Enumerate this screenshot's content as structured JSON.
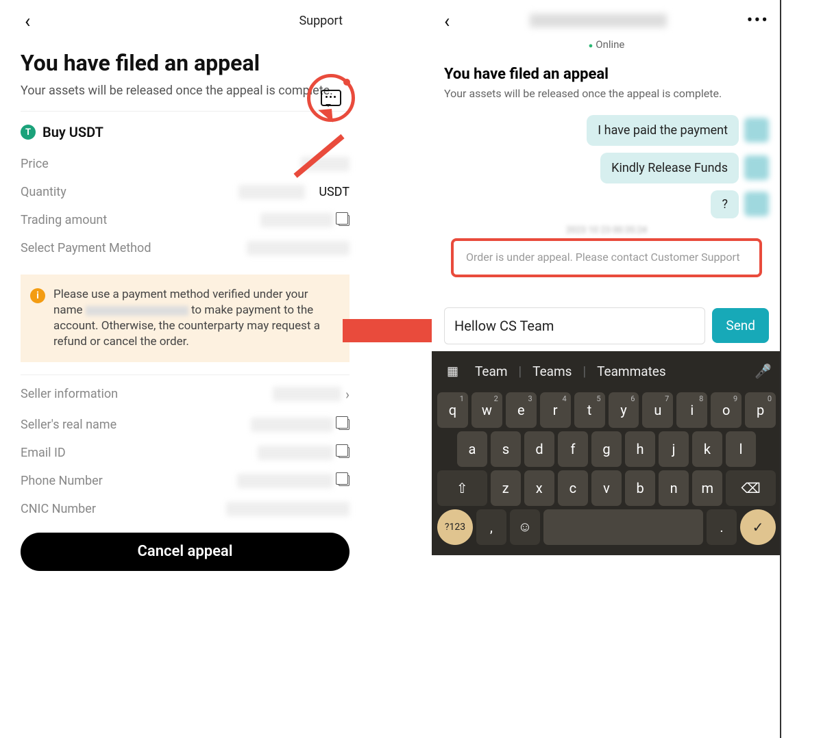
{
  "left": {
    "support_link": "Support",
    "title": "You have filed an appeal",
    "subtitle": "Your assets will be released once the appeal is complete.",
    "coin_label": "Buy USDT",
    "coin_icon_letter": "T",
    "rows": {
      "price_k": "Price",
      "price_v": "",
      "qty_k": "Quantity",
      "qty_unit": "USDT",
      "amount_k": "Trading amount",
      "method_k": "Select Payment Method"
    },
    "notice": {
      "before": "Please use a payment method verified under your name ",
      "after": " to make payment to the account. Otherwise, the counterparty may request a refund or cancel the order."
    },
    "info_icon": "i",
    "seller_info_k": "Seller information",
    "seller_name_k": "Seller's real name",
    "email_k": "Email ID",
    "phone_k": "Phone Number",
    "cnic_k": "CNIC Number",
    "cancel_btn": "Cancel appeal"
  },
  "right": {
    "status": "Online",
    "title": "You have filed an appeal",
    "subtitle": "Your assets will be released once the appeal is complete.",
    "msg1": "I have paid the payment",
    "msg2": "Kindly Release Funds",
    "msg3": "?",
    "timestamp": "2023 10 23 00:35:24",
    "appeal_notice": "Order is under appeal. Please contact Customer Support",
    "input_value": "Hellow CS Team",
    "send_btn": "Send"
  },
  "keyboard": {
    "suggestions": [
      "Team",
      "Teams",
      "Teammates"
    ],
    "row1": [
      {
        "k": "q",
        "s": "1"
      },
      {
        "k": "w",
        "s": "2"
      },
      {
        "k": "e",
        "s": "3"
      },
      {
        "k": "r",
        "s": "4"
      },
      {
        "k": "t",
        "s": "5"
      },
      {
        "k": "y",
        "s": "6"
      },
      {
        "k": "u",
        "s": "7"
      },
      {
        "k": "i",
        "s": "8"
      },
      {
        "k": "o",
        "s": "9"
      },
      {
        "k": "p",
        "s": "0"
      }
    ],
    "row2": [
      "a",
      "s",
      "d",
      "f",
      "g",
      "h",
      "j",
      "k",
      "l"
    ],
    "row3": [
      "z",
      "x",
      "c",
      "v",
      "b",
      "n",
      "m"
    ],
    "num_key": "?123",
    "comma": ",",
    "period": "."
  }
}
